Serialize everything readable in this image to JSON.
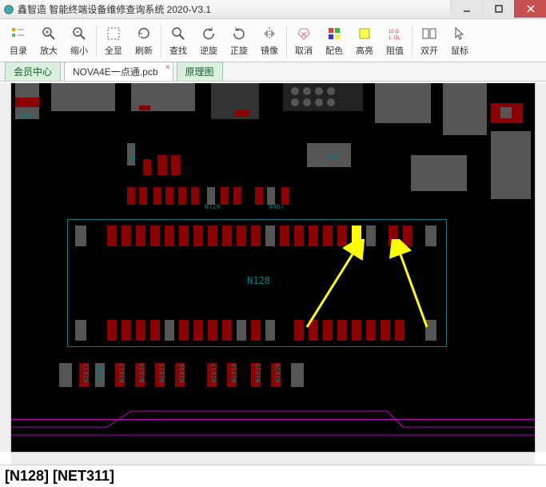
{
  "window": {
    "title": "鑫智造 智能终端设备维修查询系统 2020-V3.1"
  },
  "toolbar": {
    "catalog": "目录",
    "zoomin": "放大",
    "zoomout": "缩小",
    "fit": "全显",
    "refresh": "刷新",
    "find": "查找",
    "rotccw": "逆旋",
    "rotcw": "正旋",
    "mirror": "镜像",
    "cancel": "取消",
    "color": "配色",
    "highlight": "高亮",
    "resist": "阻值",
    "dual": "双开",
    "mouse": "鼠标"
  },
  "tabs": {
    "member": "会员中心",
    "pcb": "NOVA4E一点通.pcb",
    "schematic": "原理图"
  },
  "pcb": {
    "chip": "N128",
    "refs": {
      "n463": "N463",
      "n433": "N433",
      "n729": "N729",
      "n467": "N467",
      "z33": "Z33",
      "n1012": "N1012",
      "n146": "N146",
      "n1013": "N1013",
      "n1014": "N1014",
      "n1015": "N1015",
      "n1016": "N1016",
      "n1017": "N1017",
      "n1018": "N1018",
      "n1019": "N1019",
      "n1020": "N1020"
    }
  },
  "status": {
    "text": "[N128] [NET311]"
  }
}
